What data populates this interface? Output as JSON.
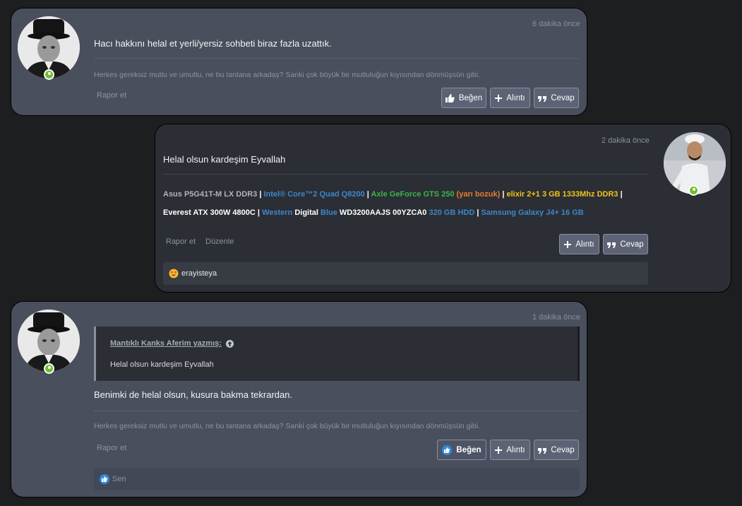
{
  "posts": [
    {
      "time": "6 dakika önce",
      "message": "Hacı hakkını helal et yerli/yersiz sohbeti biraz fazla uzattık.",
      "signature": "Herkes gereksiz mutlu ve umutlu, ne bu tantana arkadaş? Sanki çok büyük bir mutluluğun kıyısından dönmüşsün gibi.",
      "report": "Rapor et",
      "buttons": {
        "like": "Beğen",
        "quote": "Alıntı",
        "reply": "Cevap"
      }
    },
    {
      "time": "2 dakika önce",
      "message": "Helal olsun kardeşim Eyvallah",
      "specs": [
        {
          "text": "Asus P5G41T-M LX DDR3",
          "color": "gray"
        },
        {
          "text": "Intel® Core™2 Quad Q8200",
          "color": "blue"
        },
        {
          "text": "Axle GeForce GTS 250",
          "color": "green"
        },
        {
          "text": "(yarı bozuk)",
          "color": "orange"
        },
        {
          "text": "elixir 2+1 3 GB 1333Mhz DDR3",
          "color": "yellow"
        },
        {
          "text": "Everest ATX 300W 4800C",
          "color": "white"
        },
        {
          "text": "Western",
          "color": "blue"
        },
        {
          "text": "Digital",
          "color": "white"
        },
        {
          "text": "Blue",
          "color": "blue"
        },
        {
          "text": "WD3200AAJS 00YZCA0",
          "color": "white"
        },
        {
          "text": "320 GB HDD",
          "color": "blue"
        },
        {
          "text": "Samsung Galaxy J4+ 16 GB",
          "color": "blue"
        }
      ],
      "separator": "|",
      "report": "Rapor et",
      "edit": "Düzenle",
      "buttons": {
        "quote": "Alıntı",
        "reply": "Cevap"
      },
      "reaction_user": "erayisteya"
    },
    {
      "time": "1 dakika önce",
      "quote_author": "Mantıklı Kanks Aferim yazmış:",
      "quote_text": "Helal olsun kardeşim Eyvallah",
      "message": "Benimki de helal olsun, kusura bakma tekrardan.",
      "signature": "Herkes gereksiz mutlu ve umutlu, ne bu tantana arkadaş? Sanki çok büyük bir mutluluğun kıyısından dönmüşsün gibi.",
      "report": "Rapor et",
      "buttons": {
        "like": "Beğen",
        "quote": "Alıntı",
        "reply": "Cevap"
      },
      "reaction_user": "Sen"
    }
  ],
  "colors": {
    "gray": "#b0b3b8",
    "blue": "#3e86cc",
    "green": "#39b54a",
    "orange": "#e97b2f",
    "yellow": "#f0c419",
    "white": "#ffffff",
    "online": "#6fbe2e"
  }
}
